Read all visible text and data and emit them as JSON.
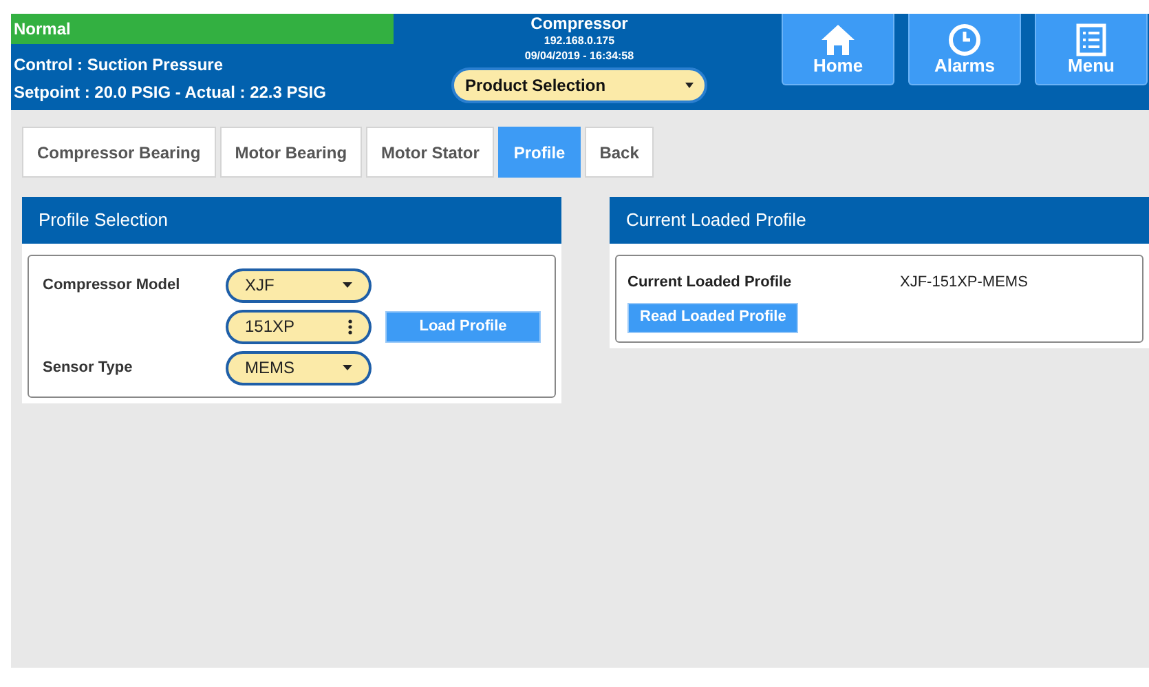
{
  "header": {
    "status": "Normal",
    "control": "Control : Suction Pressure",
    "setpoint": "Setpoint : 20.0 PSIG - Actual : 22.3 PSIG",
    "title": "Compressor",
    "ip": "192.168.0.175",
    "datetime": "09/04/2019 - 16:34:58",
    "product_select": "Product Selection",
    "nav_buttons": [
      {
        "kind": "home",
        "label": "Home"
      },
      {
        "kind": "alarms",
        "label": "Alarms"
      },
      {
        "kind": "menu",
        "label": "Menu"
      }
    ]
  },
  "tabs": [
    {
      "label": "Compressor Bearing",
      "selected": false
    },
    {
      "label": "Motor Bearing",
      "selected": false
    },
    {
      "label": "Motor Stator",
      "selected": false
    },
    {
      "label": "Profile",
      "selected": true
    },
    {
      "label": "Back",
      "selected": false
    }
  ],
  "profile_selection": {
    "title": "Profile Selection",
    "fields": [
      {
        "label": "Compressor Model",
        "value": "XJF",
        "kind": "dropdown"
      },
      {
        "value": "151XP",
        "kind": "spinner"
      },
      {
        "label": "Sensor Type",
        "value": "MEMS",
        "kind": "dropdown"
      }
    ],
    "button": "Load Profile"
  },
  "current_loaded_profile": {
    "title": "Current Loaded Profile",
    "label": "Current Loaded Profile",
    "value": "XJF-151XP-MEMS",
    "button": "Read Loaded Profile"
  }
}
